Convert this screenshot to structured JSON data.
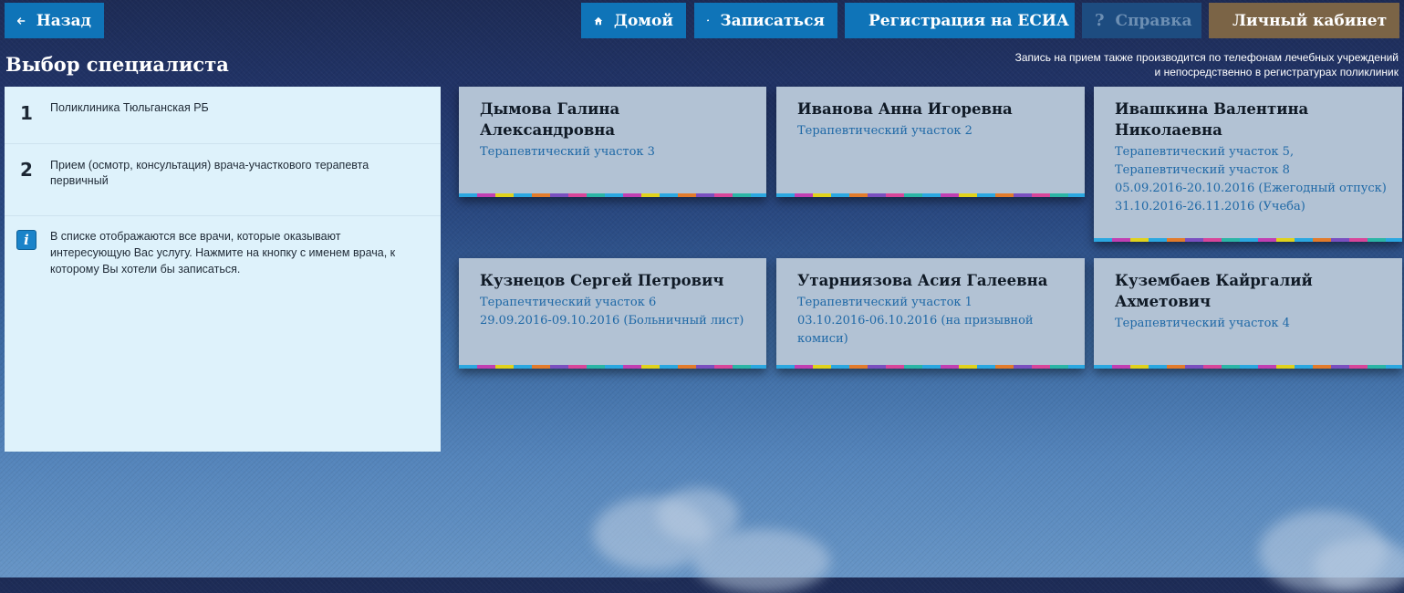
{
  "nav": {
    "back_label": "Назад",
    "home_label": "Домой",
    "signup_label": "Записаться",
    "esia_label": "Регистрация на ЕСИА",
    "help_label": "Справка",
    "cabinet_label": "Личный кабинет"
  },
  "page": {
    "title": "Выбор специалиста",
    "note_line1": "Запись на прием также производится по телефонам лечебных учреждений",
    "note_line2": "и непосредственно в регистратурах поликлиник"
  },
  "steps": [
    {
      "number": "1",
      "text": "Поликлиника Тюльганская РБ"
    },
    {
      "number": "2",
      "text": "Прием (осмотр, консультация) врача-участкового терапевта первичный"
    }
  ],
  "info": {
    "icon": "info-icon",
    "text": "В списке отображаются все врачи, которые оказывают интересующую Вас услугу. Нажмите на кнопку с именем врача, к которому Вы хотели бы записаться."
  },
  "doctors": [
    {
      "name": "Дымова Галина Александровна",
      "lines": [
        "Терапевтический участок 3"
      ]
    },
    {
      "name": "Иванова Анна Игоревна",
      "lines": [
        "Терапевтический участок 2"
      ]
    },
    {
      "name": "Ивашкина Валентина Николаевна",
      "lines": [
        "Терапевтический участок 5, Терапевтический участок 8",
        "05.09.2016-20.10.2016 (Ежегодный отпуск)",
        "31.10.2016-26.11.2016 (Учеба)"
      ]
    },
    {
      "name": "Кузнецов Сергей Петрович",
      "lines": [
        "Терапечтический участок 6",
        "29.09.2016-09.10.2016 (Больничный лист)"
      ]
    },
    {
      "name": "Утарниязова Асия Галеевна",
      "lines": [
        "Терапевтический участок 1",
        "03.10.2016-06.10.2016 (на призывной комиси)"
      ]
    },
    {
      "name": "Кузембаев Кайргалий Ахметович",
      "lines": [
        "Терапевтический участок 4"
      ]
    }
  ],
  "colors": {
    "nav_button": "#0f74b8",
    "nav_button_disabled": "#1d4c80",
    "cabinet_button": "#7b6446",
    "card_background": "#b2c2d4",
    "card_link": "#1e68a6",
    "panel_background": "#def2fb"
  }
}
